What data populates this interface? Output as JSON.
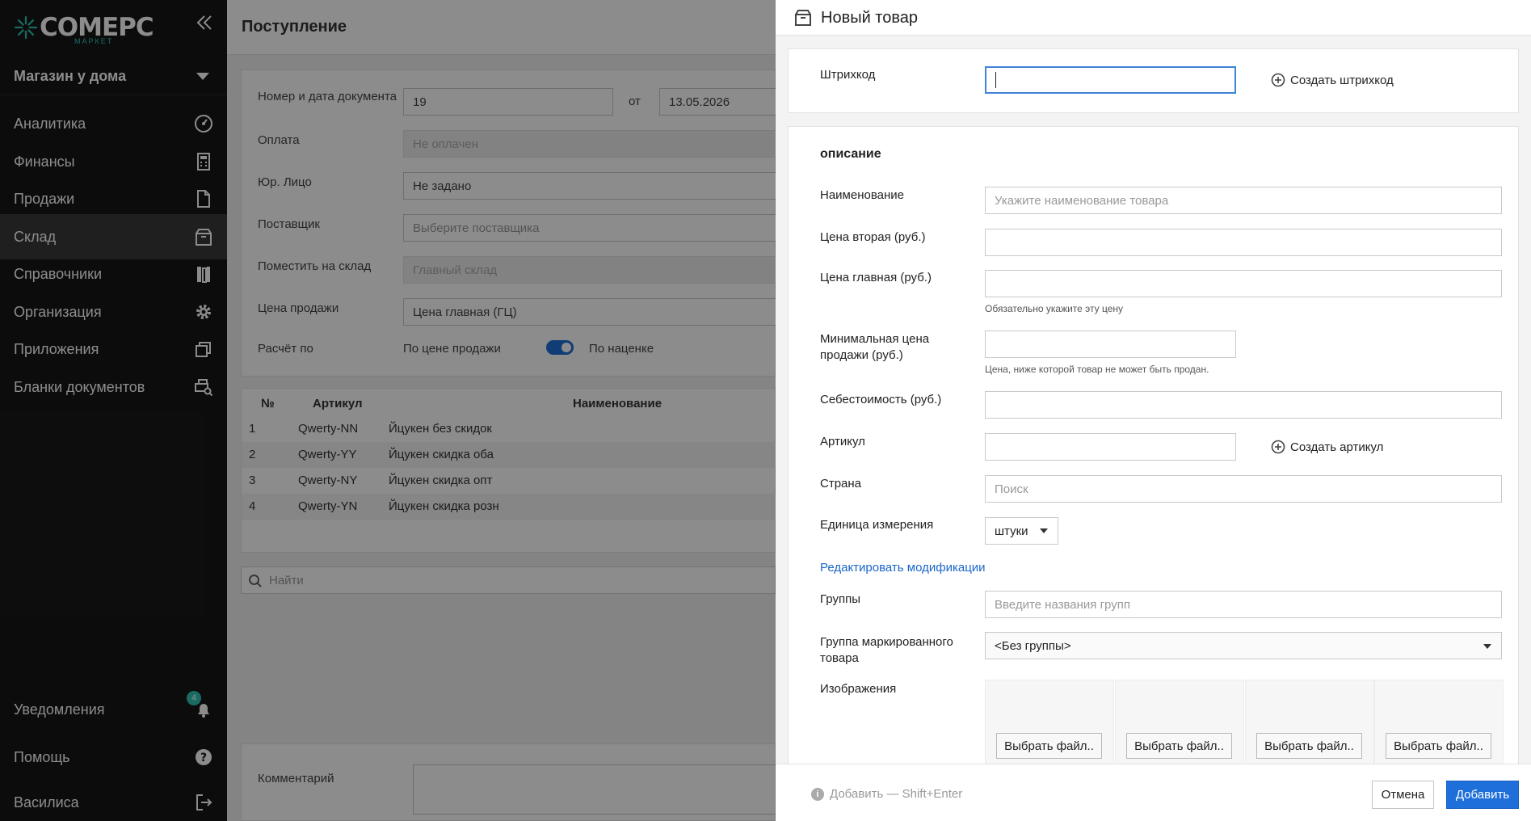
{
  "sidebar": {
    "logo_text": "COMEPC",
    "logo_sub": "МАРКЕТ",
    "store": "Магазин у дома",
    "items": [
      {
        "label": "Аналитика",
        "icon": "gauge-icon"
      },
      {
        "label": "Финансы",
        "icon": "calculator-icon"
      },
      {
        "label": "Продажи",
        "icon": "document-icon"
      },
      {
        "label": "Склад",
        "icon": "box-icon"
      },
      {
        "label": "Справочники",
        "icon": "books-icon"
      },
      {
        "label": "Организация",
        "icon": "gear-icon"
      },
      {
        "label": "Приложения",
        "icon": "windows-icon"
      },
      {
        "label": "Бланки документов",
        "icon": "print-preview-icon"
      }
    ],
    "bottom": [
      {
        "label": "Уведомления",
        "icon": "bell-icon"
      },
      {
        "label": "Помощь",
        "icon": "help-icon"
      },
      {
        "label": "Василиса",
        "icon": "logout-icon"
      }
    ],
    "notification_count": "4",
    "active_index": 3
  },
  "page": {
    "title": "Поступление",
    "labels": {
      "doc": "Номер и дата документа",
      "from": "от",
      "payment": "Оплата",
      "legal": "Юр. Лицо",
      "supplier": "Поставщик",
      "warehouse": "Поместить на склад",
      "price": "Цена продажи",
      "calc": "Расчёт по",
      "comment": "Комментарий"
    },
    "values": {
      "doc_number": "19",
      "doc_date": "13.05.2026",
      "payment": "Не оплачен",
      "legal": "Не задано",
      "supplier": "Выберите поставщика",
      "warehouse": "Главный склад",
      "price": "Цена главная (ГЦ)",
      "calc_left": "По цене продажи",
      "calc_right": "По наценке",
      "search": "Найти"
    },
    "table": {
      "columns": [
        "№",
        "Артикул",
        "Наименование"
      ],
      "rows": [
        [
          "1",
          "Qwerty-NN",
          "Йцукен без скидок"
        ],
        [
          "2",
          "Qwerty-YY",
          "Йцукен скидка оба"
        ],
        [
          "3",
          "Qwerty-NY",
          "Йцукен скидка опт"
        ],
        [
          "4",
          "Qwerty-YN",
          "Йцукен скидка розн"
        ]
      ]
    }
  },
  "modal": {
    "title": "Новый товар",
    "barcode_label": "Штрихкод",
    "barcode_value": "",
    "create_barcode": "Создать штрихкод",
    "section_title": "описание",
    "fields": {
      "name_label": "Наименование",
      "name_placeholder": "Укажите наименование товара",
      "price2_label": "Цена вторая (руб.)",
      "price_main_label": "Цена главная (руб.)",
      "price_main_hint": "Обязательно укажите эту цену",
      "min_price_label": "Минимальная цена продажи (руб.)",
      "min_price_hint": "Цена, ниже которой товар не может быть продан.",
      "cost_label": "Себестоимость (руб.)",
      "article_label": "Артикул",
      "create_article": "Создать артикул",
      "country_label": "Страна",
      "country_placeholder": "Поиск",
      "unit_label": "Единица измерения",
      "unit_value": "штуки",
      "edit_mods": "Редактировать модификации",
      "groups_label": "Группы",
      "groups_placeholder": "Введите названия групп",
      "marked_group_label": "Группа маркированного товара",
      "marked_group_value": "<Без группы>",
      "images_label": "Изображения",
      "file_button": "Выбрать файл.."
    },
    "footer": {
      "shortcut": "Добавить — Shift+Enter",
      "cancel": "Отмена",
      "add": "Добавить"
    }
  }
}
